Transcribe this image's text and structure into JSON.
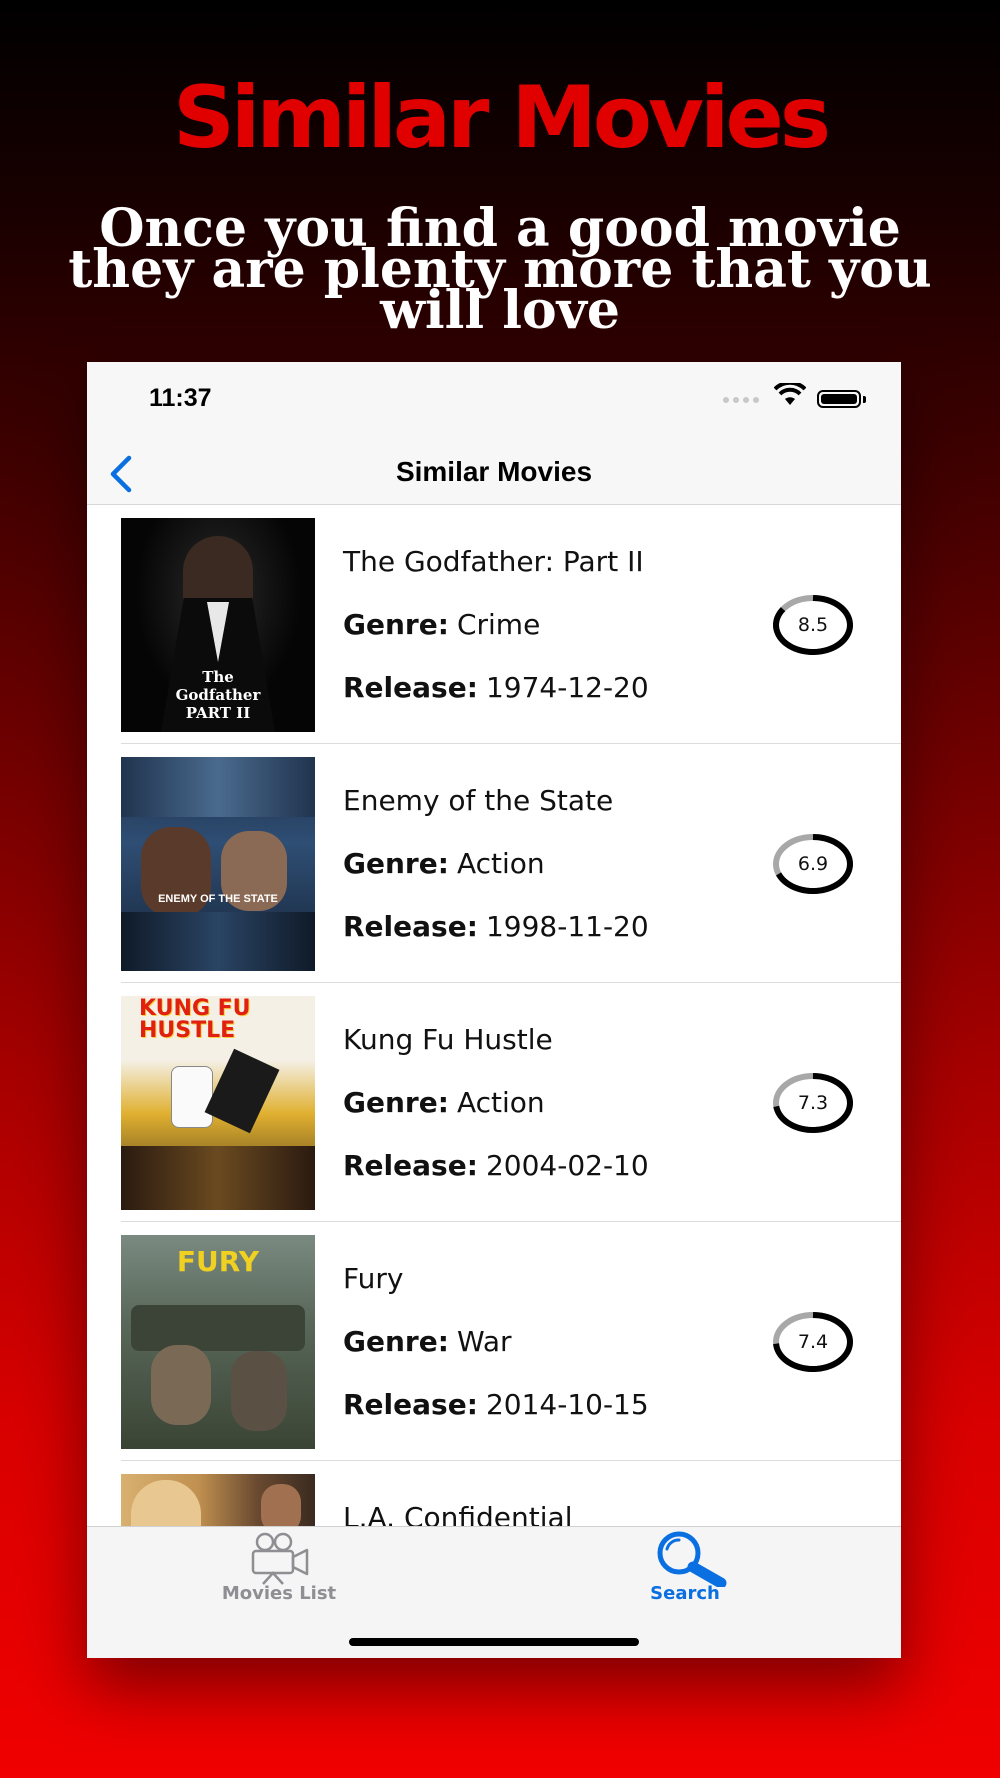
{
  "promo": {
    "title": "Similar Movies",
    "subtitle": "Once you find a good movie they are plenty more that you will love"
  },
  "status_bar": {
    "time": "11:37"
  },
  "nav": {
    "title": "Similar Movies"
  },
  "labels": {
    "genre": "Genre:",
    "release": "Release:"
  },
  "movies": [
    {
      "title": "The Godfather: Part II",
      "genre": "Crime",
      "release": "1974-12-20",
      "rating": "8.5",
      "rating_fraction": 0.85,
      "poster_text": "The Godfather PART II"
    },
    {
      "title": "Enemy of the State",
      "genre": "Action",
      "release": "1998-11-20",
      "rating": "6.9",
      "rating_fraction": 0.69,
      "poster_text": "ENEMY OF THE STATE"
    },
    {
      "title": "Kung Fu Hustle",
      "genre": "Action",
      "release": "2004-02-10",
      "rating": "7.3",
      "rating_fraction": 0.73,
      "poster_text": "KUNG FU HUSTLE"
    },
    {
      "title": "Fury",
      "genre": "War",
      "release": "2014-10-15",
      "rating": "7.4",
      "rating_fraction": 0.74,
      "poster_text": "FURY"
    },
    {
      "title": "L.A. Confidential",
      "genre": "",
      "release": "",
      "rating": "",
      "rating_fraction": 0
    }
  ],
  "tabs": [
    {
      "label": "Movies List",
      "icon": "movie-camera-icon",
      "active": false
    },
    {
      "label": "Search",
      "icon": "search-icon",
      "active": true
    }
  ],
  "colors": {
    "accent": "#0a6fe0",
    "promo_title": "#e00000",
    "inactive_tab": "#8e8e93"
  }
}
